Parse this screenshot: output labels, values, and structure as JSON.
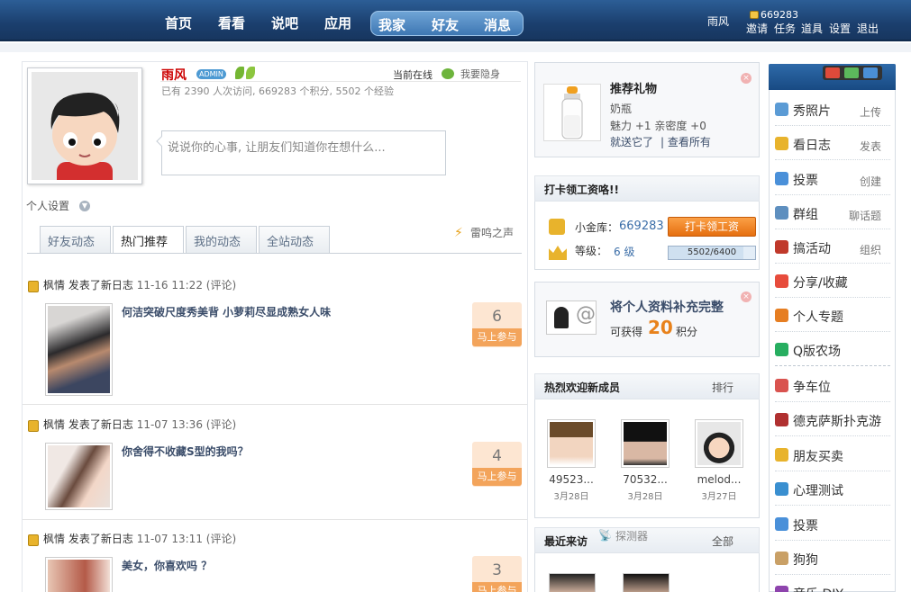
{
  "topnav": {
    "main_items": [
      "首页",
      "看看",
      "说吧",
      "应用"
    ],
    "pill_items": [
      "我家",
      "好友",
      "消息"
    ],
    "user_name": "雨风",
    "points": "669283",
    "links": [
      "邀请",
      "任务",
      "道具",
      "设置",
      "退出"
    ]
  },
  "profile": {
    "name": "雨风",
    "badge": "ADMIN",
    "online": "当前在线",
    "hide": "我要隐身",
    "stats": "已有  2390 人次访问, 669283 个积分, 5502 个经验",
    "mood_placeholder": "说说你的心事, 让朋友们知道你在想什么...",
    "settings": "个人设置"
  },
  "tabs": [
    {
      "label": "好友动态",
      "active": false
    },
    {
      "label": "热门推荐",
      "active": true
    },
    {
      "label": "我的动态",
      "active": false
    },
    {
      "label": "全站动态",
      "active": false
    }
  ],
  "thunder": "雷鸣之声",
  "feed": [
    {
      "user": "枫情",
      "action": "发表了新日志",
      "time": "11-16 11:22",
      "comment": "(评论)",
      "title": "何洁突破尺度秀美背 小萝莉尽显成熟女人味",
      "count": "6",
      "join": "马上参与"
    },
    {
      "user": "枫情",
      "action": "发表了新日志",
      "time": "11-07 13:36",
      "comment": "(评论)",
      "title": "你舍得不收藏S型的我吗？",
      "count": "4",
      "join": "马上参与"
    },
    {
      "user": "枫情",
      "action": "发表了新日志",
      "time": "11-07 13:11",
      "comment": "(评论)",
      "title": "美女，你喜欢吗  ？",
      "count": "3",
      "join": "马上参与"
    }
  ],
  "gift": {
    "title": "推荐礼物",
    "name": "奶瓶",
    "charm": "魅力 +1  亲密度 +0",
    "send": "就送它了",
    "all": "| 查看所有"
  },
  "checkin": {
    "head": "打卡领工资咯!!",
    "bank_label": "小金库：",
    "bank_value": "669283",
    "button": "打卡领工资",
    "level_label": "等级：",
    "level_value": "6 级",
    "progress_text": "5502/6400",
    "progress_fraction": 0.86
  },
  "complete": {
    "title": "将个人资料补充完整",
    "prefix": "可获得",
    "points": "20",
    "suffix": "积分"
  },
  "members": {
    "head": "热烈欢迎新成员",
    "rank": "排行",
    "list": [
      {
        "name": "49523...",
        "date": "3月28日"
      },
      {
        "name": "70532...",
        "date": "3月28日"
      },
      {
        "name": "melod...",
        "date": "3月27日"
      }
    ]
  },
  "visitors": {
    "head": "最近来访",
    "detector": "探测器",
    "all": "全部"
  },
  "apps": [
    {
      "label": "秀照片",
      "sub": "上传",
      "icon": "photo-icon",
      "color": "#5b9bd5"
    },
    {
      "label": "看日志",
      "sub": "发表",
      "icon": "blog-icon",
      "color": "#e8b32c"
    },
    {
      "label": "投票",
      "sub": "创建",
      "icon": "vote-icon",
      "color": "#4a90d9"
    },
    {
      "label": "群组",
      "sub": "聊话题",
      "icon": "group-icon",
      "color": "#5e8fbf"
    },
    {
      "label": "搞活动",
      "sub": "组织",
      "icon": "event-icon",
      "color": "#c0392b"
    },
    {
      "label": "分享/收藏",
      "sub": "",
      "icon": "share-icon",
      "color": "#e74c3c"
    },
    {
      "label": "个人专题",
      "sub": "",
      "icon": "topic-icon",
      "color": "#e67e22"
    },
    {
      "label": "Q版农场",
      "sub": "",
      "icon": "farm-icon",
      "color": "#27ae60"
    },
    {
      "label": "争车位",
      "sub": "",
      "icon": "parking-icon",
      "color": "#d9534f"
    },
    {
      "label": "德克萨斯扑克游",
      "sub": "",
      "icon": "poker-icon",
      "color": "#b03030"
    },
    {
      "label": "朋友买卖",
      "sub": "",
      "icon": "trade-icon",
      "color": "#e8b32c"
    },
    {
      "label": "心理测试",
      "sub": "",
      "icon": "test-icon",
      "color": "#3a8fd0"
    },
    {
      "label": "投票",
      "sub": "",
      "icon": "vote2-icon",
      "color": "#4a90d9"
    },
    {
      "label": "狗狗",
      "sub": "",
      "icon": "dog-icon",
      "color": "#c9a066"
    },
    {
      "label": "音乐 DIY",
      "sub": "",
      "icon": "music-icon",
      "color": "#8e44ad"
    }
  ]
}
